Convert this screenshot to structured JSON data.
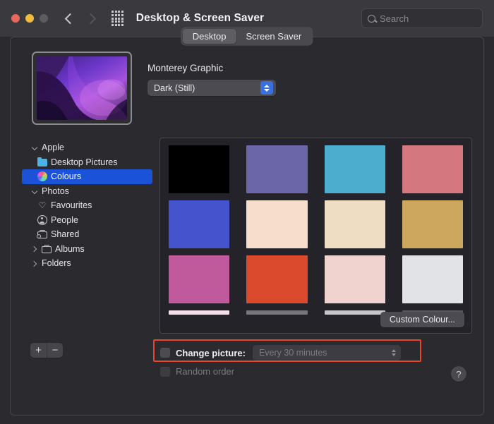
{
  "window": {
    "title": "Desktop & Screen Saver",
    "traffic_lights": [
      "close",
      "minimize",
      "zoom"
    ],
    "nav": {
      "back_icon": "chevron-left-icon",
      "forward_icon": "chevron-right-icon"
    },
    "grid_icon": "show-all-grid-icon",
    "search": {
      "placeholder": "Search",
      "value": "",
      "icon": "search-icon"
    }
  },
  "tabs": [
    {
      "label": "Desktop",
      "active": true
    },
    {
      "label": "Screen Saver",
      "active": false
    }
  ],
  "preview": {
    "wallpaper_name": "Monterey Graphic",
    "appearance_popup": {
      "value": "Dark (Still)",
      "stepper_color": "#3a6fe0"
    },
    "thumbnail_name": "monterey-wallpaper-thumbnail"
  },
  "sidebar": {
    "items": [
      {
        "label": "Apple",
        "level": 0,
        "disclosure": "open",
        "icon": null,
        "selected": false
      },
      {
        "label": "Desktop Pictures",
        "level": 1,
        "disclosure": null,
        "icon": "folder-icon",
        "selected": false
      },
      {
        "label": "Colours",
        "level": 1,
        "disclosure": null,
        "icon": "colour-wheel-icon",
        "selected": true
      },
      {
        "label": "Photos",
        "level": 0,
        "disclosure": "open",
        "icon": null,
        "selected": false
      },
      {
        "label": "Favourites",
        "level": 1,
        "disclosure": null,
        "icon": "heart-icon",
        "selected": false
      },
      {
        "label": "People",
        "level": 1,
        "disclosure": null,
        "icon": "person-icon",
        "selected": false
      },
      {
        "label": "Shared",
        "level": 1,
        "disclosure": null,
        "icon": "shared-album-icon",
        "selected": false
      },
      {
        "label": "Albums",
        "level": 1,
        "disclosure": "closed",
        "icon": "album-icon",
        "selected": false
      },
      {
        "label": "Folders",
        "level": 0,
        "disclosure": "closed",
        "icon": null,
        "selected": false
      }
    ],
    "add_button": "+",
    "remove_button": "−"
  },
  "swatches": {
    "rows": [
      [
        "#000000",
        "#6a66a8",
        "#4cadcf",
        "#d4777f"
      ],
      [
        "#4553cc",
        "#f5dfcc",
        "#eeddc3",
        "#cda75d"
      ],
      [
        "#c05a9c",
        "#dc4a2e",
        "#f0d3ce",
        "#e2e3e6"
      ]
    ],
    "partial_row": [
      "#f7dfe7",
      "#77767c",
      "#c6c5ca",
      "#5a5960"
    ],
    "custom_button": "Custom Colour..."
  },
  "footer": {
    "change_picture": {
      "label": "Change picture:",
      "checked": false,
      "interval_value": "Every 30 minutes",
      "enabled": false,
      "highlight_color": "#e8452a"
    },
    "random_order": {
      "label": "Random order",
      "checked": false,
      "enabled": false
    },
    "help_button": "?"
  }
}
